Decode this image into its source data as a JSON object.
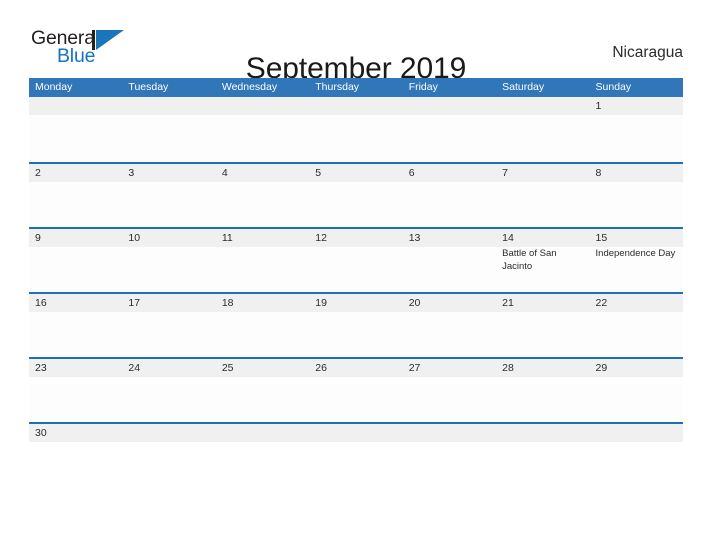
{
  "brand": {
    "word_one": "General",
    "word_two": "Blue",
    "mark": "triangle-logo"
  },
  "header": {
    "title": "September 2019",
    "country": "Nicaragua"
  },
  "calendar": {
    "weekdays": [
      "Monday",
      "Tuesday",
      "Wednesday",
      "Thursday",
      "Friday",
      "Saturday",
      "Sunday"
    ],
    "colors": {
      "header_blue": "#3076b9",
      "divider_blue": "#1f6fb5",
      "daynum_band": "#f0f0f0",
      "logo_blue": "#1b75bb",
      "text": "#2b2b2b"
    },
    "weeks": [
      [
        {
          "day": "",
          "events": []
        },
        {
          "day": "",
          "events": []
        },
        {
          "day": "",
          "events": []
        },
        {
          "day": "",
          "events": []
        },
        {
          "day": "",
          "events": []
        },
        {
          "day": "",
          "events": []
        },
        {
          "day": "1",
          "events": []
        }
      ],
      [
        {
          "day": "2",
          "events": []
        },
        {
          "day": "3",
          "events": []
        },
        {
          "day": "4",
          "events": []
        },
        {
          "day": "5",
          "events": []
        },
        {
          "day": "6",
          "events": []
        },
        {
          "day": "7",
          "events": []
        },
        {
          "day": "8",
          "events": []
        }
      ],
      [
        {
          "day": "9",
          "events": []
        },
        {
          "day": "10",
          "events": []
        },
        {
          "day": "11",
          "events": []
        },
        {
          "day": "12",
          "events": []
        },
        {
          "day": "13",
          "events": []
        },
        {
          "day": "14",
          "events": [
            "Battle of San Jacinto"
          ]
        },
        {
          "day": "15",
          "events": [
            "Independence Day"
          ]
        }
      ],
      [
        {
          "day": "16",
          "events": []
        },
        {
          "day": "17",
          "events": []
        },
        {
          "day": "18",
          "events": []
        },
        {
          "day": "19",
          "events": []
        },
        {
          "day": "20",
          "events": []
        },
        {
          "day": "21",
          "events": []
        },
        {
          "day": "22",
          "events": []
        }
      ],
      [
        {
          "day": "23",
          "events": []
        },
        {
          "day": "24",
          "events": []
        },
        {
          "day": "25",
          "events": []
        },
        {
          "day": "26",
          "events": []
        },
        {
          "day": "27",
          "events": []
        },
        {
          "day": "28",
          "events": []
        },
        {
          "day": "29",
          "events": []
        }
      ],
      [
        {
          "day": "30",
          "events": []
        },
        {
          "day": "",
          "events": []
        },
        {
          "day": "",
          "events": []
        },
        {
          "day": "",
          "events": []
        },
        {
          "day": "",
          "events": []
        },
        {
          "day": "",
          "events": []
        },
        {
          "day": "",
          "events": []
        }
      ]
    ]
  }
}
